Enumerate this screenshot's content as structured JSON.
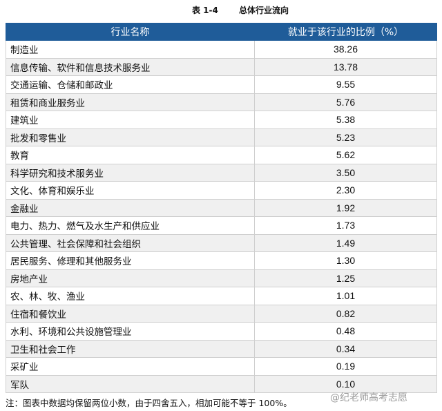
{
  "caption": {
    "number": "表 1-4",
    "title": "总体行业流向"
  },
  "table": {
    "headers": [
      "行业名称",
      "就业于该行业的比例（%）"
    ],
    "rows": [
      {
        "name": "制造业",
        "value": "38.26"
      },
      {
        "name": "信息传输、软件和信息技术服务业",
        "value": "13.78"
      },
      {
        "name": "交通运输、仓储和邮政业",
        "value": "9.55"
      },
      {
        "name": "租赁和商业服务业",
        "value": "5.76"
      },
      {
        "name": "建筑业",
        "value": "5.38"
      },
      {
        "name": "批发和零售业",
        "value": "5.23"
      },
      {
        "name": "教育",
        "value": "5.62"
      },
      {
        "name": "科学研究和技术服务业",
        "value": "3.50"
      },
      {
        "name": "文化、体育和娱乐业",
        "value": "2.30"
      },
      {
        "name": "金融业",
        "value": "1.92"
      },
      {
        "name": "电力、热力、燃气及水生产和供应业",
        "value": "1.73"
      },
      {
        "name": "公共管理、社会保障和社会组织",
        "value": "1.49"
      },
      {
        "name": "居民服务、修理和其他服务业",
        "value": "1.30"
      },
      {
        "name": "房地产业",
        "value": "1.25"
      },
      {
        "name": "农、林、牧、渔业",
        "value": "1.01"
      },
      {
        "name": "住宿和餐饮业",
        "value": "0.82"
      },
      {
        "name": "水利、环境和公共设施管理业",
        "value": "0.48"
      },
      {
        "name": "卫生和社会工作",
        "value": "0.34"
      },
      {
        "name": "采矿业",
        "value": "0.19"
      },
      {
        "name": "军队",
        "value": "0.10"
      }
    ]
  },
  "note": "注：图表中数据均保留两位小数，由于四舍五入，相加可能不等于 100%。",
  "watermark": "@纪老师高考志愿",
  "colors": {
    "header_bg": "#1f5c99",
    "header_text": "#ffffff",
    "alt_row": "#f0f0f0"
  }
}
